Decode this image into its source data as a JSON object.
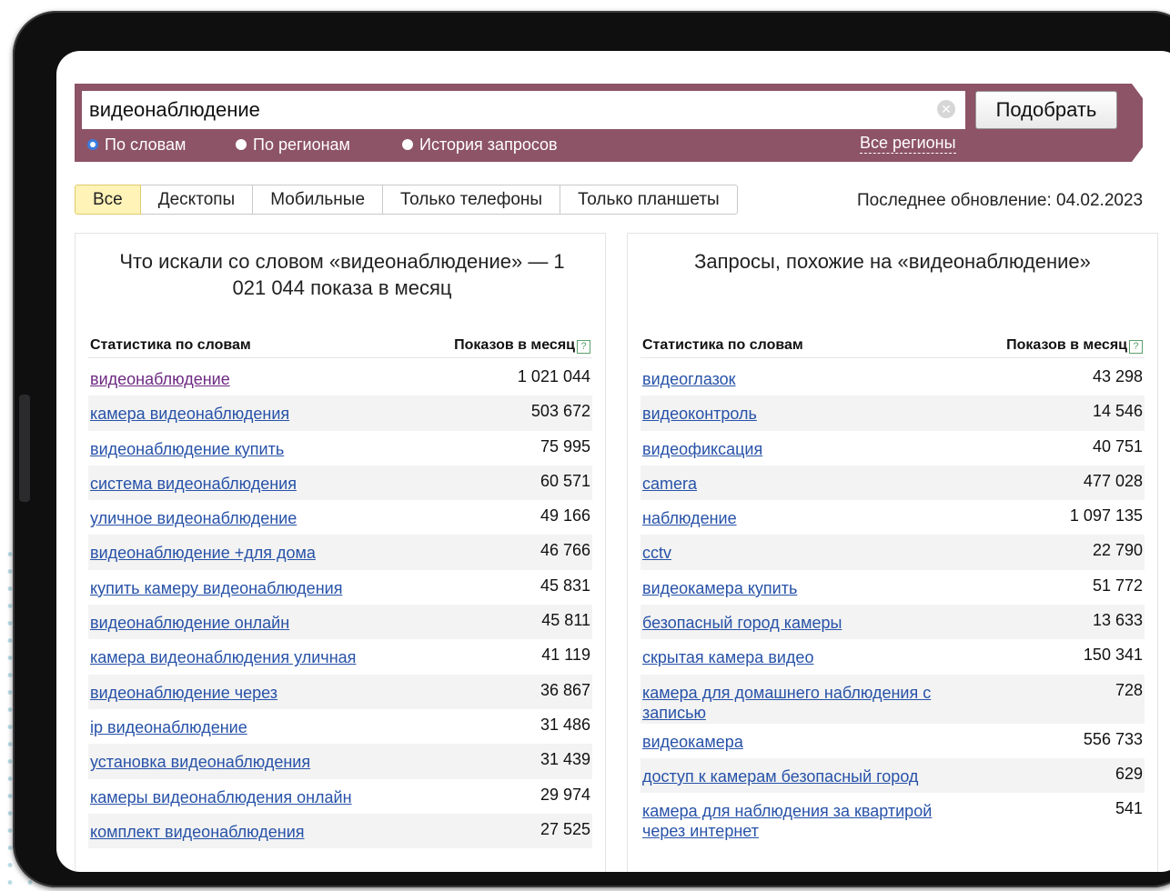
{
  "search": {
    "query": "видеонаблюдение",
    "button_label": "Подобрать",
    "modes": [
      {
        "label": "По словам",
        "checked": true
      },
      {
        "label": "По регионам",
        "checked": false
      },
      {
        "label": "История запросов",
        "checked": false
      }
    ],
    "regions_label": "Все регионы"
  },
  "device_tabs": [
    "Все",
    "Десктопы",
    "Мобильные",
    "Только телефоны",
    "Только планшеты"
  ],
  "active_tab": "Все",
  "last_update": "Последнее обновление: 04.02.2023",
  "left_panel": {
    "title": "Что искали со словом «видеонаблюдение» — 1 021 044 показа в месяц",
    "col_phrase": "Статистика по словам",
    "col_count": "Показов в месяц",
    "rows": [
      {
        "phrase": "видеонаблюдение",
        "count": "1 021 044"
      },
      {
        "phrase": "камера видеонаблюдения",
        "count": "503 672"
      },
      {
        "phrase": "видеонаблюдение купить",
        "count": "75 995"
      },
      {
        "phrase": "система видеонаблюдения",
        "count": "60 571"
      },
      {
        "phrase": "уличное видеонаблюдение",
        "count": "49 166"
      },
      {
        "phrase": "видеонаблюдение +для дома",
        "count": "46 766"
      },
      {
        "phrase": "купить камеру видеонаблюдения",
        "count": "45 831"
      },
      {
        "phrase": "видеонаблюдение онлайн",
        "count": "45 811"
      },
      {
        "phrase": "камера видеонаблюдения уличная",
        "count": "41 119"
      },
      {
        "phrase": "видеонаблюдение через",
        "count": "36 867"
      },
      {
        "phrase": "ip видеонаблюдение",
        "count": "31 486"
      },
      {
        "phrase": "установка видеонаблюдения",
        "count": "31 439"
      },
      {
        "phrase": "камеры видеонаблюдения онлайн",
        "count": "29 974"
      },
      {
        "phrase": "комплект видеонаблюдения",
        "count": "27 525"
      }
    ]
  },
  "right_panel": {
    "title": "Запросы, похожие на «видеонаблюдение»",
    "col_phrase": "Статистика по словам",
    "col_count": "Показов в месяц",
    "rows": [
      {
        "phrase": "видеоглазок",
        "count": "43 298"
      },
      {
        "phrase": "видеоконтроль",
        "count": "14 546"
      },
      {
        "phrase": "видеофиксация",
        "count": "40 751"
      },
      {
        "phrase": "camera",
        "count": "477 028"
      },
      {
        "phrase": "наблюдение",
        "count": "1 097 135"
      },
      {
        "phrase": "cctv",
        "count": "22 790"
      },
      {
        "phrase": "видеокамера купить",
        "count": "51 772"
      },
      {
        "phrase": "безопасный город камеры",
        "count": "13 633"
      },
      {
        "phrase": "скрытая камера видео",
        "count": "150 341"
      },
      {
        "phrase": "камера для домашнего наблюдения с записью",
        "count": "728"
      },
      {
        "phrase": "видеокамера",
        "count": "556 733"
      },
      {
        "phrase": "доступ к камерам безопасный город",
        "count": "629"
      },
      {
        "phrase": "камера для наблюдения за квартирой через интернет",
        "count": "541"
      }
    ]
  },
  "colors": {
    "search_band": "#8d5367",
    "link": "#2752a8",
    "visited_link": "#6d2a82",
    "active_tab_bg": "#fff3b8",
    "radio_selected": "#3b7de0"
  }
}
